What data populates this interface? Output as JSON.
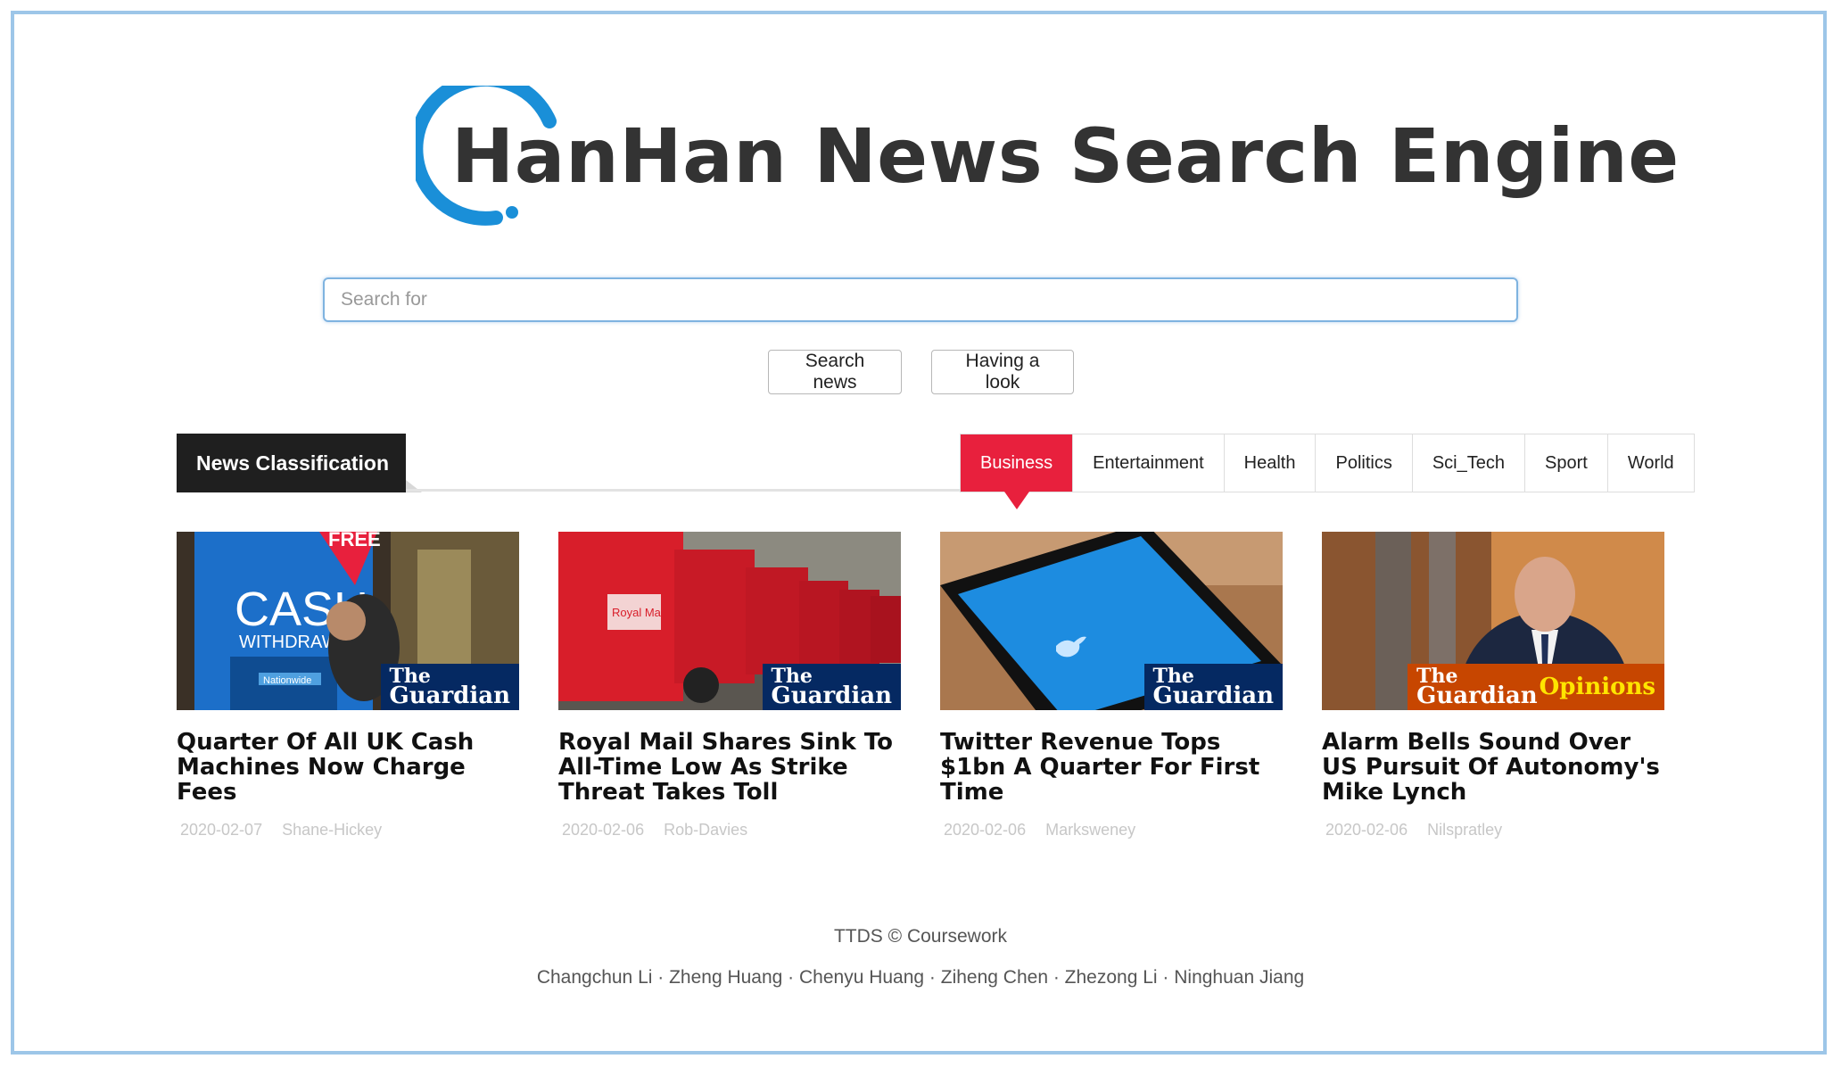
{
  "header": {
    "title": "HanHan News Search Engine",
    "accent_color": "#1a8fd8"
  },
  "search": {
    "placeholder": "Search for",
    "value": "",
    "search_button": "Search news",
    "look_button": "Having a look"
  },
  "classification": {
    "label": "News Classification",
    "active_tab": "Business",
    "active_color": "#e8203d",
    "tabs": [
      "Business",
      "Entertainment",
      "Health",
      "Politics",
      "Sci_Tech",
      "Sport",
      "World"
    ]
  },
  "articles": [
    {
      "title": "Quarter Of All UK Cash Machines Now Charge Fees",
      "date": "2020-02-07",
      "author": "Shane-Hickey",
      "badge_line1": "The",
      "badge_line2": "Guardian",
      "image_texts": [
        "FREE",
        "CASH",
        "WITHDRAWA",
        "Nationwide"
      ]
    },
    {
      "title": "Royal Mail Shares Sink To All-Time Low As Strike Threat Takes Toll",
      "date": "2020-02-06",
      "author": "Rob-Davies",
      "badge_line1": "The",
      "badge_line2": "Guardian",
      "image_texts": [
        "Royal Mail"
      ]
    },
    {
      "title": "Twitter Revenue Tops $1bn A Quarter For First Time",
      "date": "2020-02-06",
      "author": "Marksweney",
      "badge_line1": "The",
      "badge_line2": "Guardian",
      "image_texts": []
    },
    {
      "title": "Alarm Bells Sound Over US Pursuit Of Autonomy's Mike Lynch",
      "date": "2020-02-06",
      "author": "Nilspratley",
      "badge_line1": "The",
      "badge_line2": "Guardian",
      "badge_extra": "Opinions",
      "image_texts": []
    }
  ],
  "footer": {
    "line1": "TTDS © Coursework",
    "line2": "Changchun Li · Zheng Huang · Chenyu Huang · Ziheng Chen · Zhezong Li · Ninghuan Jiang"
  }
}
